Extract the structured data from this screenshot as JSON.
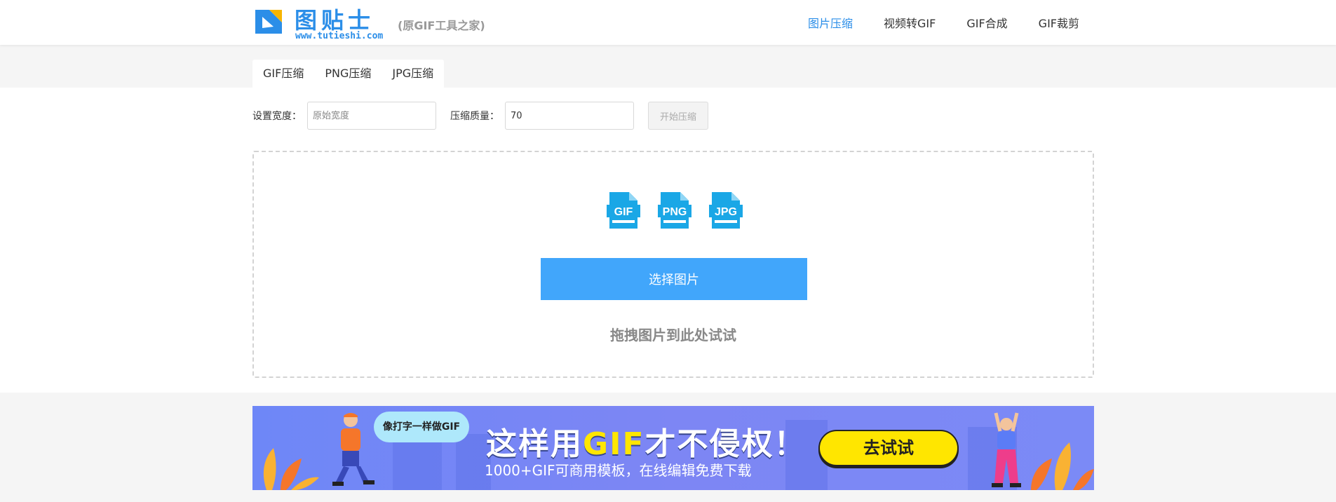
{
  "header": {
    "logo_title": "图贴士",
    "logo_url": "www.tutieshi.com",
    "logo_sub": "(原GIF工具之家)",
    "nav": [
      {
        "label": "图片压缩",
        "active": true
      },
      {
        "label": "视频转GIF",
        "active": false
      },
      {
        "label": "GIF合成",
        "active": false
      },
      {
        "label": "GIF裁剪",
        "active": false
      }
    ]
  },
  "tabs": [
    {
      "label": "GIF压缩"
    },
    {
      "label": "PNG压缩"
    },
    {
      "label": "JPG压缩"
    }
  ],
  "settings": {
    "width_label": "设置宽度：",
    "width_placeholder": "原始宽度",
    "width_value": "",
    "quality_label": "压缩质量：",
    "quality_value": "70",
    "start_label": "开始压缩"
  },
  "dropzone": {
    "icons": [
      {
        "label": "GIF",
        "icon": "gif-file-icon"
      },
      {
        "label": "PNG",
        "icon": "png-file-icon"
      },
      {
        "label": "JPG",
        "icon": "jpg-file-icon"
      }
    ],
    "select_label": "选择图片",
    "hint": "拖拽图片到此处试试"
  },
  "banner": {
    "bubble": "像打字一样做GIF",
    "headline_pre": "这样用",
    "headline_gif": "GIF",
    "headline_post": "才不侵权！",
    "sub": "1000+GIF可商用模板，在线编辑免费下载",
    "cta": "去试试"
  },
  "colors": {
    "accent": "#2b8ee8",
    "button": "#41a6fb",
    "icon": "#1aa7e6",
    "banner": "#7287f6",
    "cta": "#ffe600"
  }
}
